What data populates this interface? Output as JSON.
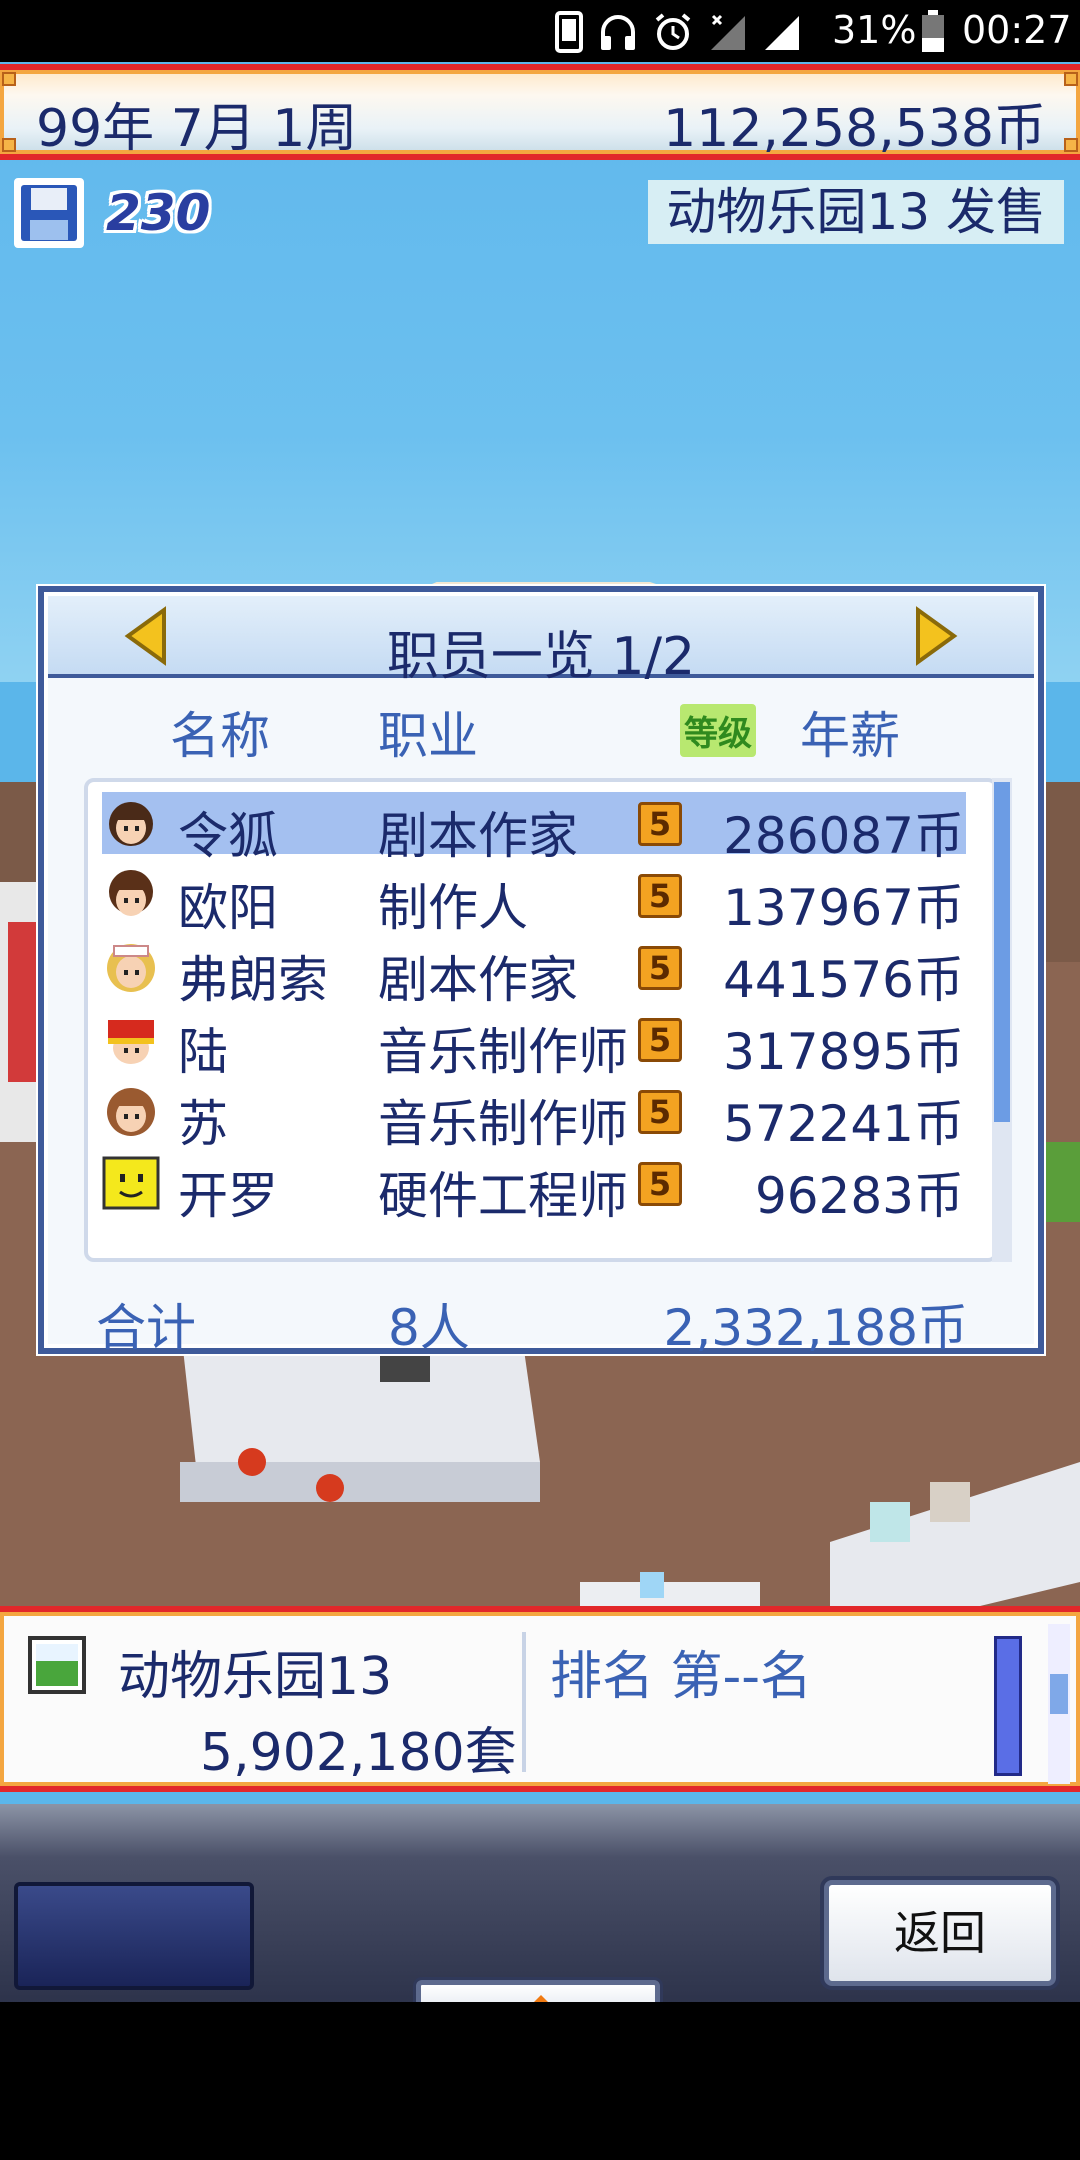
{
  "status_bar": {
    "battery_percent": "31%",
    "time": "00:27",
    "icons": [
      "phone-vibrate-icon",
      "headphones-icon",
      "alarm-icon",
      "no-signal-icon",
      "signal-icon",
      "battery-icon"
    ]
  },
  "top_bar": {
    "date": "99年 7月 1周",
    "money": "112,258,538币"
  },
  "save": {
    "count": "230"
  },
  "release_banner": "动物乐园13 发售",
  "dialog": {
    "title": "职员一览 1/2",
    "columns": {
      "name": "名称",
      "job": "职业",
      "grade": "等级",
      "salary": "年薪"
    },
    "staff": [
      {
        "name": "令狐",
        "job": "剧本作家",
        "level": "5",
        "salary": "286087币",
        "selected": true
      },
      {
        "name": "欧阳",
        "job": "制作人",
        "level": "5",
        "salary": "137967币",
        "selected": false
      },
      {
        "name": "弗朗索",
        "job": "剧本作家",
        "level": "5",
        "salary": "441576币",
        "selected": false
      },
      {
        "name": "陆",
        "job": "音乐制作师",
        "level": "5",
        "salary": "317895币",
        "selected": false
      },
      {
        "name": "苏",
        "job": "音乐制作师",
        "level": "5",
        "salary": "572241币",
        "selected": false
      },
      {
        "name": "开罗",
        "job": "硬件工程师",
        "level": "5",
        "salary": "96283币",
        "selected": false
      }
    ],
    "totals": {
      "label": "合计",
      "count": "8人",
      "amount": "2,332,188币"
    }
  },
  "game_info": {
    "title": "动物乐园13",
    "sales": "5,902,180套",
    "rank": "排名 第--名"
  },
  "menu": {
    "back_label": "返回"
  },
  "colors": {
    "accent_red": "#e2272a",
    "text_navy": "#1b2a6b",
    "text_blue": "#3a62b4",
    "selection": "#a4c0f0"
  }
}
